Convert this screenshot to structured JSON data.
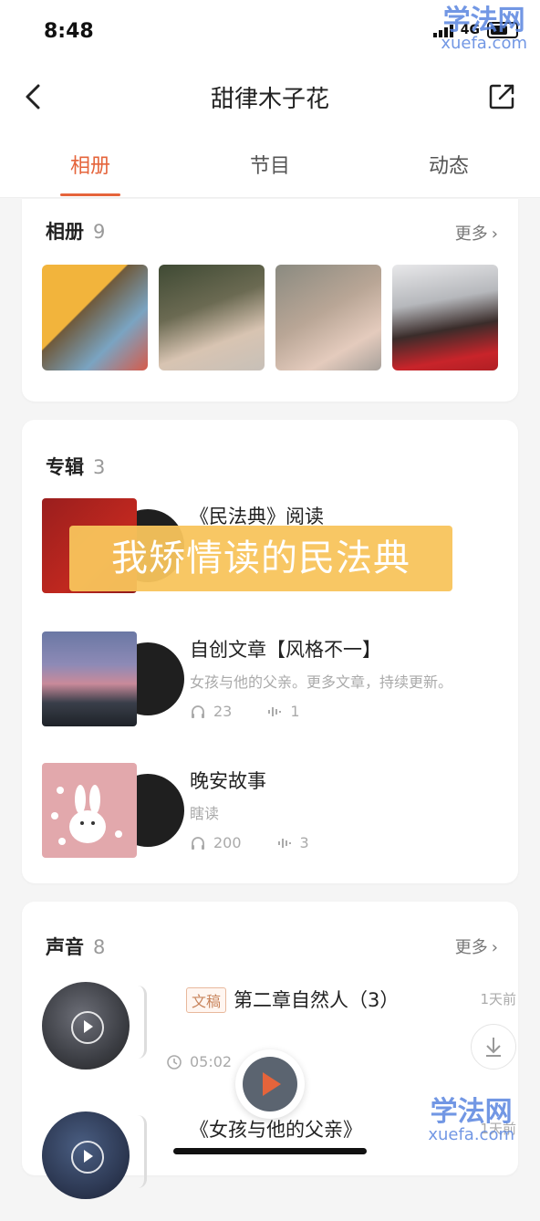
{
  "status": {
    "time": "8:48",
    "network": "4G"
  },
  "watermark": {
    "logo": "学法网",
    "url": "xuefa.com"
  },
  "nav": {
    "title": "甜律木子花"
  },
  "tabs": [
    {
      "label": "相册"
    },
    {
      "label": "节目"
    },
    {
      "label": "动态"
    }
  ],
  "photos_section": {
    "title": "相册",
    "count": "9",
    "more": "更多"
  },
  "albums_section": {
    "title": "专辑",
    "count": "3",
    "items": [
      {
        "title": "《民法典》阅读",
        "desc": "",
        "plays": "",
        "tracks": ""
      },
      {
        "title": "自创文章【风格不一】",
        "desc": "女孩与他的父亲。更多文章，持续更新。",
        "plays": "23",
        "tracks": "1"
      },
      {
        "title": "晚安故事",
        "desc": "瞎读",
        "plays": "200",
        "tracks": "3"
      }
    ],
    "overlay": "我矫情读的民法典"
  },
  "sounds_section": {
    "title": "声音",
    "count": "8",
    "more": "更多",
    "items": [
      {
        "badge": "文稿",
        "title": "第二章自然人（3）",
        "time": "1天前",
        "duration": "05:02",
        "progress": "%"
      },
      {
        "badge": "",
        "title": "《女孩与他的父亲》",
        "time": "1天前",
        "duration": "",
        "progress": ""
      }
    ]
  },
  "colors": {
    "accent": "#e5643b",
    "overlay": "#f8c45c",
    "watermark": "#5a86e0"
  },
  "icons": [
    "back-arrow-icon",
    "share-icon",
    "chevron-right-icon",
    "headphones-icon",
    "waveform-icon",
    "clock-icon",
    "download-icon",
    "play-icon"
  ]
}
